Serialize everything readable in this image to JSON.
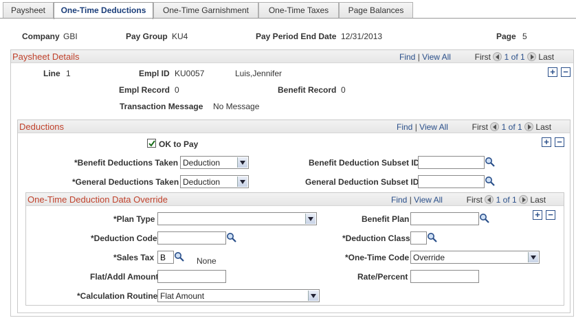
{
  "tabs": [
    "Paysheet",
    "One-Time Deductions",
    "One-Time Garnishment",
    "One-Time Taxes",
    "Page Balances"
  ],
  "header": {
    "company_label": "Company",
    "company_value": "GBI",
    "paygroup_label": "Pay Group",
    "paygroup_value": "KU4",
    "ppend_label": "Pay Period End Date",
    "ppend_value": "12/31/2013",
    "page_label": "Page",
    "page_value": "5"
  },
  "nav": {
    "find": "Find",
    "sep": "|",
    "view_all": "View All",
    "first": "First",
    "of": "1 of 1",
    "last": "Last"
  },
  "paysheet": {
    "title": "Paysheet Details",
    "line_label": "Line",
    "line_value": "1",
    "emplid_label": "Empl ID",
    "emplid_value": "KU0057",
    "name_value": "Luis,Jennifer",
    "emplrec_label": "Empl Record",
    "emplrec_value": "0",
    "benrec_label": "Benefit Record",
    "benrec_value": "0",
    "txmsg_label": "Transaction Message",
    "txmsg_value": "No Message"
  },
  "deductions": {
    "title": "Deductions",
    "ok_label": "OK to Pay",
    "ok_checked": true,
    "bdt_label": "*Benefit Deductions Taken",
    "bdt_value": "Deduction",
    "gdt_label": "*General Deductions Taken",
    "gdt_value": "Deduction",
    "bdsub_label": "Benefit Deduction Subset ID",
    "bdsub_value": "",
    "gdsub_label": "General Deduction Subset ID",
    "gdsub_value": ""
  },
  "override": {
    "title": "One-Time Deduction Data Override",
    "plan_type_label": "*Plan Type",
    "plan_type_value": "",
    "benefit_plan_label": "Benefit Plan",
    "benefit_plan_value": "",
    "ded_code_label": "*Deduction Code",
    "ded_code_value": "",
    "ded_class_label": "*Deduction Class",
    "ded_class_value": "",
    "sales_tax_label": "*Sales Tax",
    "sales_tax_value": "B",
    "sales_tax_desc": "None",
    "otc_label": "*One-Time Code",
    "otc_value": "Override",
    "flat_label": "Flat/Addl Amount",
    "flat_value": "",
    "rate_label": "Rate/Percent",
    "rate_value": "",
    "calc_label": "*Calculation Routine",
    "calc_value": "Flat Amount"
  }
}
